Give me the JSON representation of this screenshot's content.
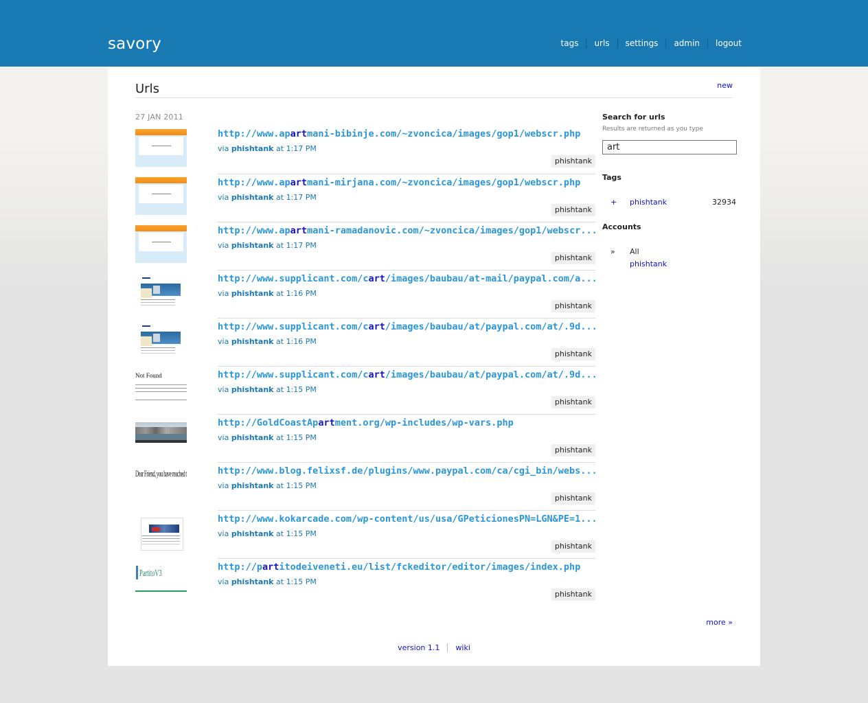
{
  "app": {
    "name": "savory",
    "nav": [
      "tags",
      "urls",
      "settings",
      "admin",
      "logout"
    ]
  },
  "page": {
    "title": "Urls",
    "new_label": "new",
    "date": "27 JAN 2011",
    "more_label": "more »"
  },
  "urls": [
    {
      "pre": "http://www.ap",
      "hl": "art",
      "post": "mani-bibinje.com/~zvoncica/images/gop1/webscr.php",
      "via": "via",
      "source": "phishtank",
      "time_prefix": "at",
      "time": "1:17 PM",
      "tag": "phishtank",
      "thumb": "orange"
    },
    {
      "pre": "http://www.ap",
      "hl": "art",
      "post": "mani-mirjana.com/~zvoncica/images/gop1/webscr.php",
      "via": "via",
      "source": "phishtank",
      "time_prefix": "at",
      "time": "1:17 PM",
      "tag": "phishtank",
      "thumb": "orange"
    },
    {
      "pre": "http://www.ap",
      "hl": "art",
      "post": "mani-ramadanovic.com/~zvoncica/images/gop1/webscr...",
      "via": "via",
      "source": "phishtank",
      "time_prefix": "at",
      "time": "1:17 PM",
      "tag": "phishtank",
      "thumb": "orange"
    },
    {
      "pre": "http://www.supplicant.com/c",
      "hl": "art",
      "post": "/images/baubau/at-mail/paypal.com/a...",
      "via": "via",
      "source": "phishtank",
      "time_prefix": "at",
      "time": "1:16 PM",
      "tag": "phishtank",
      "thumb": "paypal"
    },
    {
      "pre": "http://www.supplicant.com/c",
      "hl": "art",
      "post": "/images/baubau/at/paypal.com/at/.9d...",
      "via": "via",
      "source": "phishtank",
      "time_prefix": "at",
      "time": "1:16 PM",
      "tag": "phishtank",
      "thumb": "paypal"
    },
    {
      "pre": "http://www.supplicant.com/c",
      "hl": "art",
      "post": "/images/baubau/at/paypal.com/at/.9d...",
      "via": "via",
      "source": "phishtank",
      "time_prefix": "at",
      "time": "1:15 PM",
      "tag": "phishtank",
      "thumb": "notfound"
    },
    {
      "pre": "http://GoldCoastAp",
      "hl": "art",
      "post": "ment.org/wp-includes/wp-vars.php",
      "via": "via",
      "source": "phishtank",
      "time_prefix": "at",
      "time": "1:15 PM",
      "tag": "phishtank",
      "thumb": "beach"
    },
    {
      "pre": "http://www.blog.felixsf.de/plugins/www.paypal.com/ca/cgi_bin/webs...",
      "hl": "",
      "post": "",
      "via": "via",
      "source": "phishtank",
      "time_prefix": "at",
      "time": "1:15 PM",
      "tag": "phishtank",
      "thumb": "text"
    },
    {
      "pre": "http://www.kokarcade.com/wp-content/us/usa/GPeticionesPN=LGN&PE=1...",
      "hl": "",
      "post": "",
      "via": "via",
      "source": "phishtank",
      "time_prefix": "at",
      "time": "1:15 PM",
      "tag": "phishtank",
      "thumb": "shop"
    },
    {
      "pre": "http://p",
      "hl": "art",
      "post": "itodeiveneti.eu/list/fckeditor/editor/images/index.php",
      "via": "via",
      "source": "phishtank",
      "time_prefix": "at",
      "time": "1:15 PM",
      "tag": "phishtank",
      "thumb": "pv"
    }
  ],
  "sidebar": {
    "search_title": "Search for urls",
    "search_hint": "Results are returned as you type",
    "search_value": "art",
    "tags_title": "Tags",
    "tags": [
      {
        "op": "+",
        "name": "phishtank",
        "count": "32934"
      }
    ],
    "accounts_title": "Accounts",
    "accounts_marker": "»",
    "accounts_all": "All",
    "accounts": [
      "phishtank"
    ]
  },
  "footer": {
    "links": [
      "version 1.1",
      "wiki"
    ]
  },
  "thumb_text": {
    "notfound": "Not Found",
    "text": "Dear Friend, you have reached this page by mistake.",
    "pv": "PartitoV3"
  },
  "colors": {
    "header": "#1879b3",
    "url_link": "#2a96d8",
    "highlight": "#1212c9",
    "link": "#1010c8"
  }
}
